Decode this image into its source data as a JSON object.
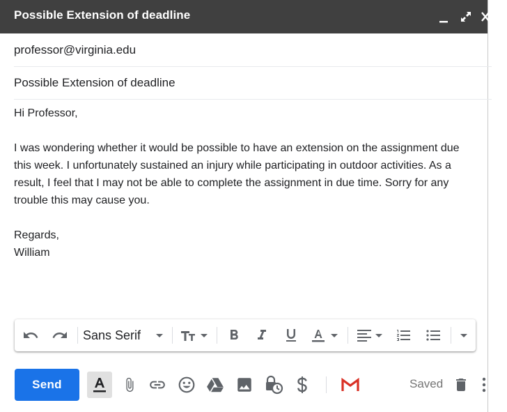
{
  "window": {
    "title": "Possible Extension of deadline"
  },
  "fields": {
    "to": "professor@virginia.edu",
    "subject": "Possible Extension of deadline"
  },
  "message": {
    "greeting": "Hi Professor,",
    "paragraph_lines": [
      "I was wondering whether it would be possible to have an extension on the assignment due",
      "this week. I unfortunately sustained an injury while participating in outdoor activities. As a",
      "result, I feel that I may not be able to complete the assignment in due time. Sorry for any",
      "trouble this may cause you."
    ],
    "closing": "Regards,",
    "signature": "William"
  },
  "format_toolbar": {
    "font_name": "Sans Serif"
  },
  "bottom_bar": {
    "send_label": "Send",
    "saved_label": "Saved"
  },
  "colors": {
    "titlebar_bg": "#404040",
    "send_bg": "#1a73e8",
    "gmail_red": "#d93025",
    "icon_gray": "#5f6368"
  },
  "icons": {
    "titlebar": [
      "minimize-icon",
      "expand-icon",
      "close-icon"
    ],
    "toolbar": [
      "undo-icon",
      "redo-icon",
      "dropdown-arrow-icon",
      "text-size-icon",
      "bold-icon",
      "italic-icon",
      "underline-icon",
      "text-color-icon",
      "align-icon",
      "numbered-list-icon",
      "bulleted-list-icon",
      "more-formatting-icon"
    ],
    "bottom": [
      "formatting-options-icon",
      "attach-file-icon",
      "insert-link-icon",
      "emoji-icon",
      "google-drive-icon",
      "insert-photo-icon",
      "confidential-mode-icon",
      "send-money-icon",
      "gmail-logo-icon",
      "delete-icon",
      "more-options-icon"
    ]
  }
}
